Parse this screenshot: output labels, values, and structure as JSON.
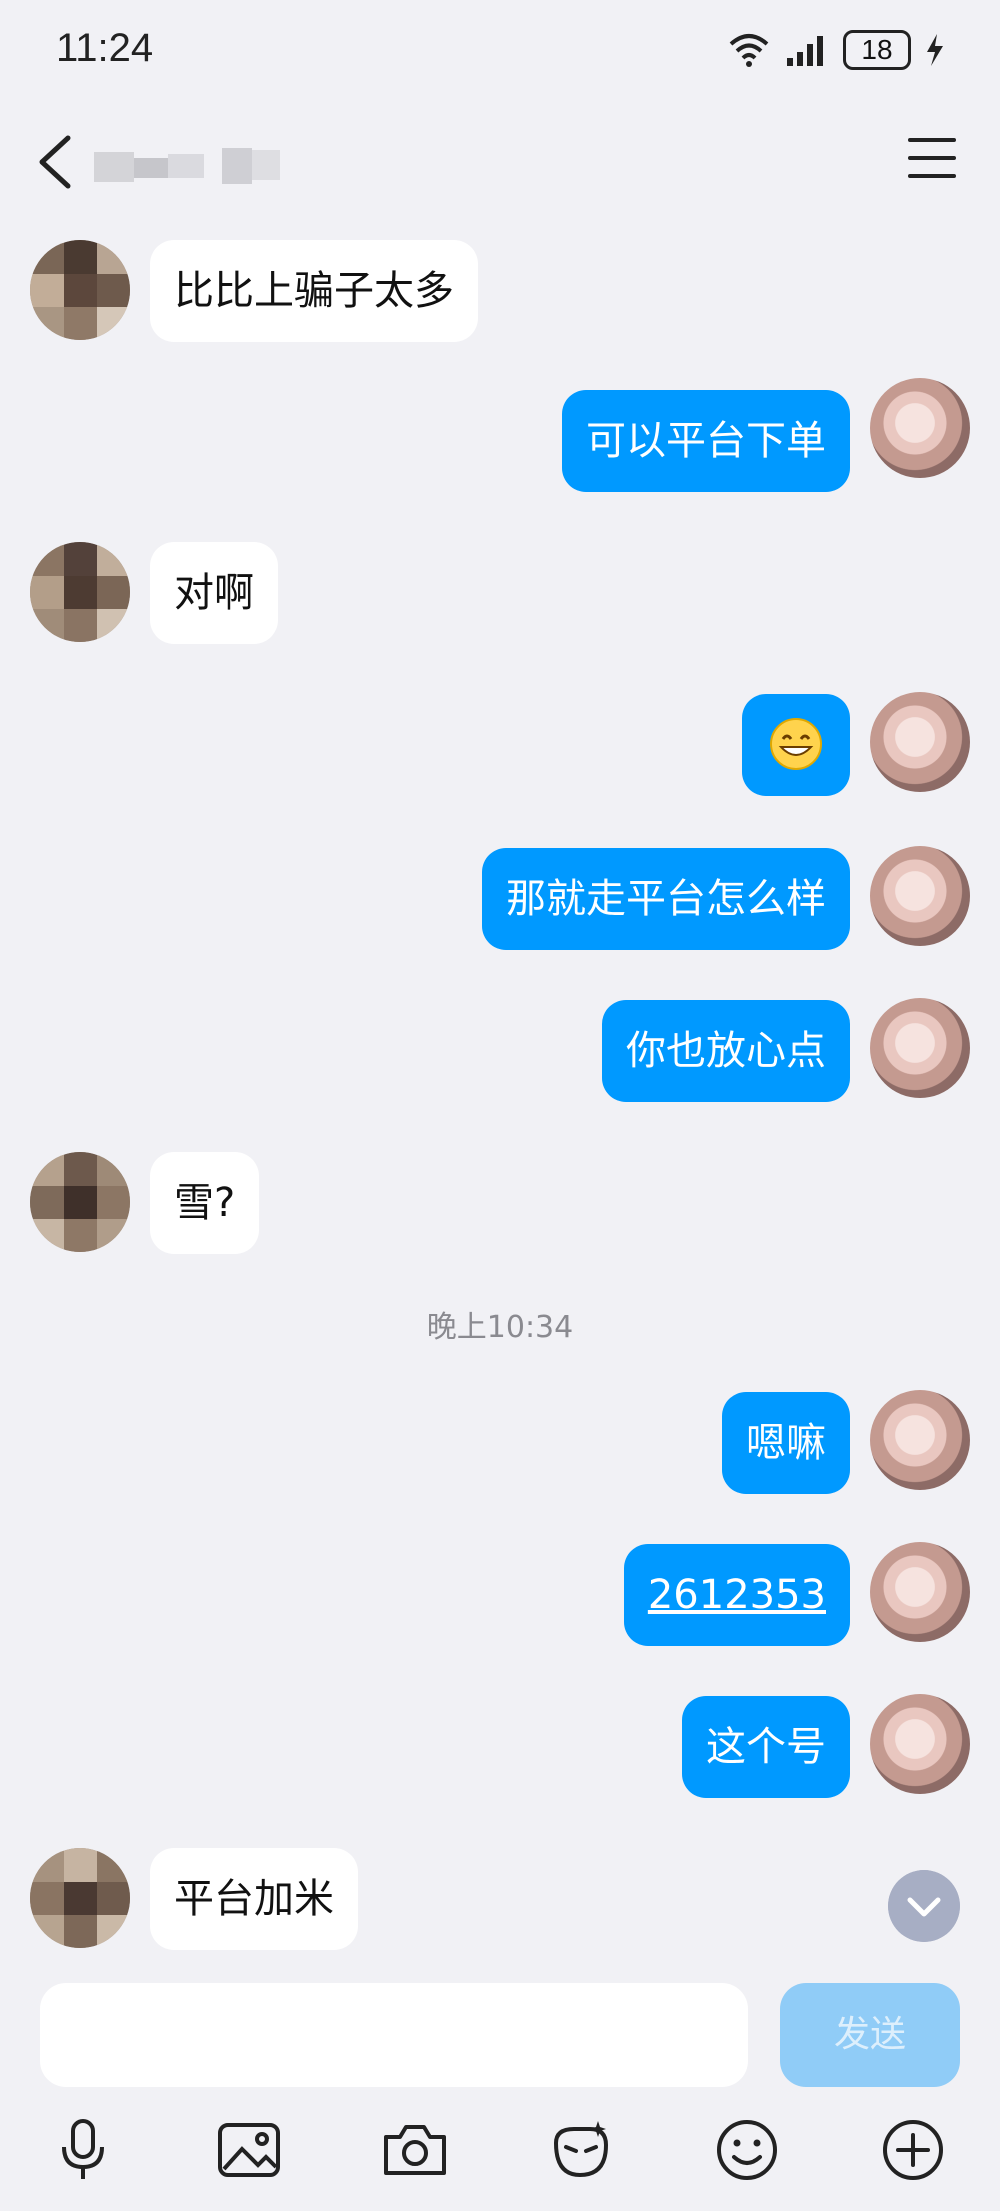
{
  "status_bar": {
    "time": "11:24",
    "battery": "18"
  },
  "header": {
    "contact_name_blurred": ""
  },
  "messages": [
    {
      "side": "in",
      "text": "比比上骗子太多"
    },
    {
      "side": "out",
      "text": "可以平台下单"
    },
    {
      "side": "in",
      "text": "对啊"
    },
    {
      "side": "out",
      "text": "😁"
    },
    {
      "side": "out",
      "text": "那就走平台怎么样"
    },
    {
      "side": "out",
      "text": "你也放心点"
    },
    {
      "side": "in",
      "text": "雪?"
    },
    {
      "side": "out",
      "text": "嗯嘛"
    },
    {
      "side": "out",
      "text": "2612353"
    },
    {
      "side": "out",
      "text": "这个号"
    },
    {
      "side": "in",
      "text": "平台加米"
    }
  ],
  "timestamp": "晚上10:34",
  "input": {
    "placeholder": "",
    "send_label": "发送"
  },
  "toolbar": {
    "icons": [
      "microphone-icon",
      "image-icon",
      "camera-icon",
      "sticker-icon",
      "emoji-icon",
      "plus-icon"
    ]
  },
  "colors": {
    "outgoing_bubble": "#0099ff",
    "incoming_bubble": "#ffffff",
    "background": "#f1f1f5",
    "send_button": "#90ccf7"
  }
}
